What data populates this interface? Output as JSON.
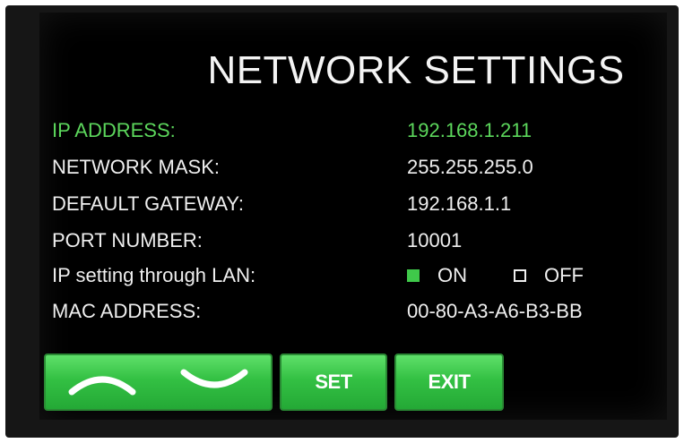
{
  "screen": {
    "title": "NETWORK SETTINGS",
    "rows": [
      {
        "label": "IP ADDRESS:",
        "value": "192.168.1.211",
        "selected": true
      },
      {
        "label": "NETWORK MASK:",
        "value": "255.255.255.0",
        "selected": false
      },
      {
        "label": "DEFAULT GATEWAY:",
        "value": "192.168.1.1",
        "selected": false
      },
      {
        "label": "PORT NUMBER:",
        "value": "10001",
        "selected": false
      }
    ],
    "lan_setting": {
      "label": "IP setting through LAN:",
      "options": [
        {
          "label": "ON",
          "checked": true
        },
        {
          "label": "OFF",
          "checked": false
        }
      ]
    },
    "mac": {
      "label": "MAC ADDRESS:",
      "value": "00-80-A3-A6-B3-BB"
    }
  },
  "buttons": {
    "up_icon": "chevron-up-icon",
    "down_icon": "chevron-down-icon",
    "set_label": "SET",
    "exit_label": "EXIT"
  },
  "colors": {
    "selected_text": "#5cd75c",
    "button_green": "#33c043",
    "background": "#000000"
  }
}
